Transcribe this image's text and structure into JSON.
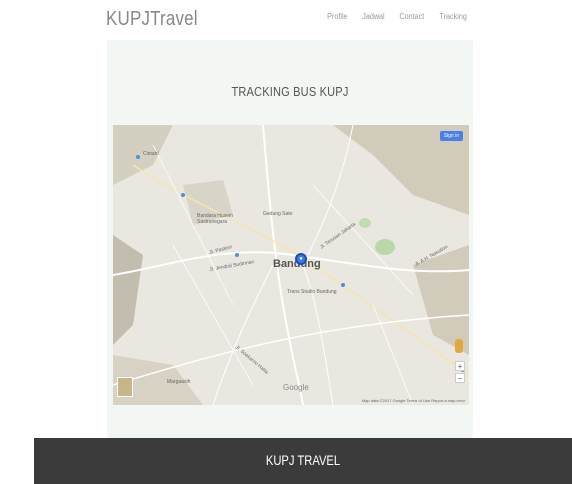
{
  "header": {
    "brand": "KUPJTravel",
    "nav": [
      "Profile",
      "Jadwal",
      "Contact",
      "Tracking"
    ]
  },
  "main": {
    "title": "TRACKING BUS KUPJ"
  },
  "map": {
    "city_label": "Bandung",
    "labels": [
      "Cimahi",
      "Gedung Sate",
      "Bandara Husein Sastranegara",
      "Trans Studio Bandung",
      "Margaasih",
      "Jl. Jendral Sudirman",
      "Jl. Soekarno Hatta",
      "Jl. Pasteur",
      "Jl. Terusan Jakarta",
      "Jl. A.H. Nasution"
    ],
    "sign_in": "Sign in",
    "google": "Google",
    "attribution": "Map data ©2017 Google   Terms of Use   Report a map error",
    "zoom_in": "+",
    "zoom_out": "−"
  },
  "footer": {
    "text": "KUPJ TRAVEL"
  },
  "colors": {
    "panel_bg": "#f2f7f4",
    "footer_bg": "#3b3b3b",
    "accent": "#3a78e8"
  }
}
